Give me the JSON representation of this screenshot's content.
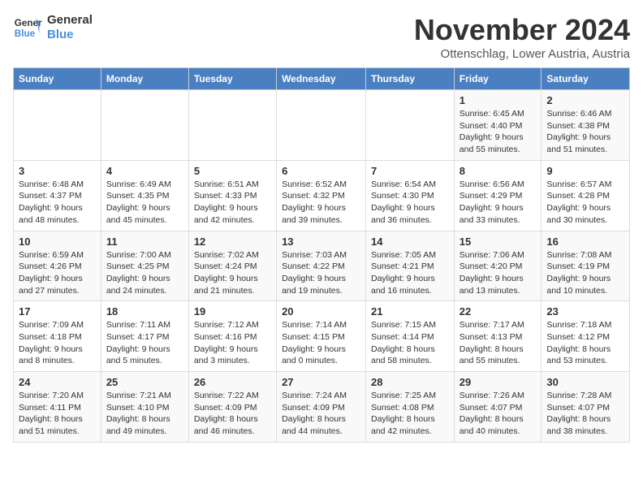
{
  "logo": {
    "line1": "General",
    "line2": "Blue"
  },
  "title": "November 2024",
  "location": "Ottenschlag, Lower Austria, Austria",
  "days_of_week": [
    "Sunday",
    "Monday",
    "Tuesday",
    "Wednesday",
    "Thursday",
    "Friday",
    "Saturday"
  ],
  "weeks": [
    [
      {
        "day": "",
        "info": ""
      },
      {
        "day": "",
        "info": ""
      },
      {
        "day": "",
        "info": ""
      },
      {
        "day": "",
        "info": ""
      },
      {
        "day": "",
        "info": ""
      },
      {
        "day": "1",
        "info": "Sunrise: 6:45 AM\nSunset: 4:40 PM\nDaylight: 9 hours and 55 minutes."
      },
      {
        "day": "2",
        "info": "Sunrise: 6:46 AM\nSunset: 4:38 PM\nDaylight: 9 hours and 51 minutes."
      }
    ],
    [
      {
        "day": "3",
        "info": "Sunrise: 6:48 AM\nSunset: 4:37 PM\nDaylight: 9 hours and 48 minutes."
      },
      {
        "day": "4",
        "info": "Sunrise: 6:49 AM\nSunset: 4:35 PM\nDaylight: 9 hours and 45 minutes."
      },
      {
        "day": "5",
        "info": "Sunrise: 6:51 AM\nSunset: 4:33 PM\nDaylight: 9 hours and 42 minutes."
      },
      {
        "day": "6",
        "info": "Sunrise: 6:52 AM\nSunset: 4:32 PM\nDaylight: 9 hours and 39 minutes."
      },
      {
        "day": "7",
        "info": "Sunrise: 6:54 AM\nSunset: 4:30 PM\nDaylight: 9 hours and 36 minutes."
      },
      {
        "day": "8",
        "info": "Sunrise: 6:56 AM\nSunset: 4:29 PM\nDaylight: 9 hours and 33 minutes."
      },
      {
        "day": "9",
        "info": "Sunrise: 6:57 AM\nSunset: 4:28 PM\nDaylight: 9 hours and 30 minutes."
      }
    ],
    [
      {
        "day": "10",
        "info": "Sunrise: 6:59 AM\nSunset: 4:26 PM\nDaylight: 9 hours and 27 minutes."
      },
      {
        "day": "11",
        "info": "Sunrise: 7:00 AM\nSunset: 4:25 PM\nDaylight: 9 hours and 24 minutes."
      },
      {
        "day": "12",
        "info": "Sunrise: 7:02 AM\nSunset: 4:24 PM\nDaylight: 9 hours and 21 minutes."
      },
      {
        "day": "13",
        "info": "Sunrise: 7:03 AM\nSunset: 4:22 PM\nDaylight: 9 hours and 19 minutes."
      },
      {
        "day": "14",
        "info": "Sunrise: 7:05 AM\nSunset: 4:21 PM\nDaylight: 9 hours and 16 minutes."
      },
      {
        "day": "15",
        "info": "Sunrise: 7:06 AM\nSunset: 4:20 PM\nDaylight: 9 hours and 13 minutes."
      },
      {
        "day": "16",
        "info": "Sunrise: 7:08 AM\nSunset: 4:19 PM\nDaylight: 9 hours and 10 minutes."
      }
    ],
    [
      {
        "day": "17",
        "info": "Sunrise: 7:09 AM\nSunset: 4:18 PM\nDaylight: 9 hours and 8 minutes."
      },
      {
        "day": "18",
        "info": "Sunrise: 7:11 AM\nSunset: 4:17 PM\nDaylight: 9 hours and 5 minutes."
      },
      {
        "day": "19",
        "info": "Sunrise: 7:12 AM\nSunset: 4:16 PM\nDaylight: 9 hours and 3 minutes."
      },
      {
        "day": "20",
        "info": "Sunrise: 7:14 AM\nSunset: 4:15 PM\nDaylight: 9 hours and 0 minutes."
      },
      {
        "day": "21",
        "info": "Sunrise: 7:15 AM\nSunset: 4:14 PM\nDaylight: 8 hours and 58 minutes."
      },
      {
        "day": "22",
        "info": "Sunrise: 7:17 AM\nSunset: 4:13 PM\nDaylight: 8 hours and 55 minutes."
      },
      {
        "day": "23",
        "info": "Sunrise: 7:18 AM\nSunset: 4:12 PM\nDaylight: 8 hours and 53 minutes."
      }
    ],
    [
      {
        "day": "24",
        "info": "Sunrise: 7:20 AM\nSunset: 4:11 PM\nDaylight: 8 hours and 51 minutes."
      },
      {
        "day": "25",
        "info": "Sunrise: 7:21 AM\nSunset: 4:10 PM\nDaylight: 8 hours and 49 minutes."
      },
      {
        "day": "26",
        "info": "Sunrise: 7:22 AM\nSunset: 4:09 PM\nDaylight: 8 hours and 46 minutes."
      },
      {
        "day": "27",
        "info": "Sunrise: 7:24 AM\nSunset: 4:09 PM\nDaylight: 8 hours and 44 minutes."
      },
      {
        "day": "28",
        "info": "Sunrise: 7:25 AM\nSunset: 4:08 PM\nDaylight: 8 hours and 42 minutes."
      },
      {
        "day": "29",
        "info": "Sunrise: 7:26 AM\nSunset: 4:07 PM\nDaylight: 8 hours and 40 minutes."
      },
      {
        "day": "30",
        "info": "Sunrise: 7:28 AM\nSunset: 4:07 PM\nDaylight: 8 hours and 38 minutes."
      }
    ]
  ]
}
